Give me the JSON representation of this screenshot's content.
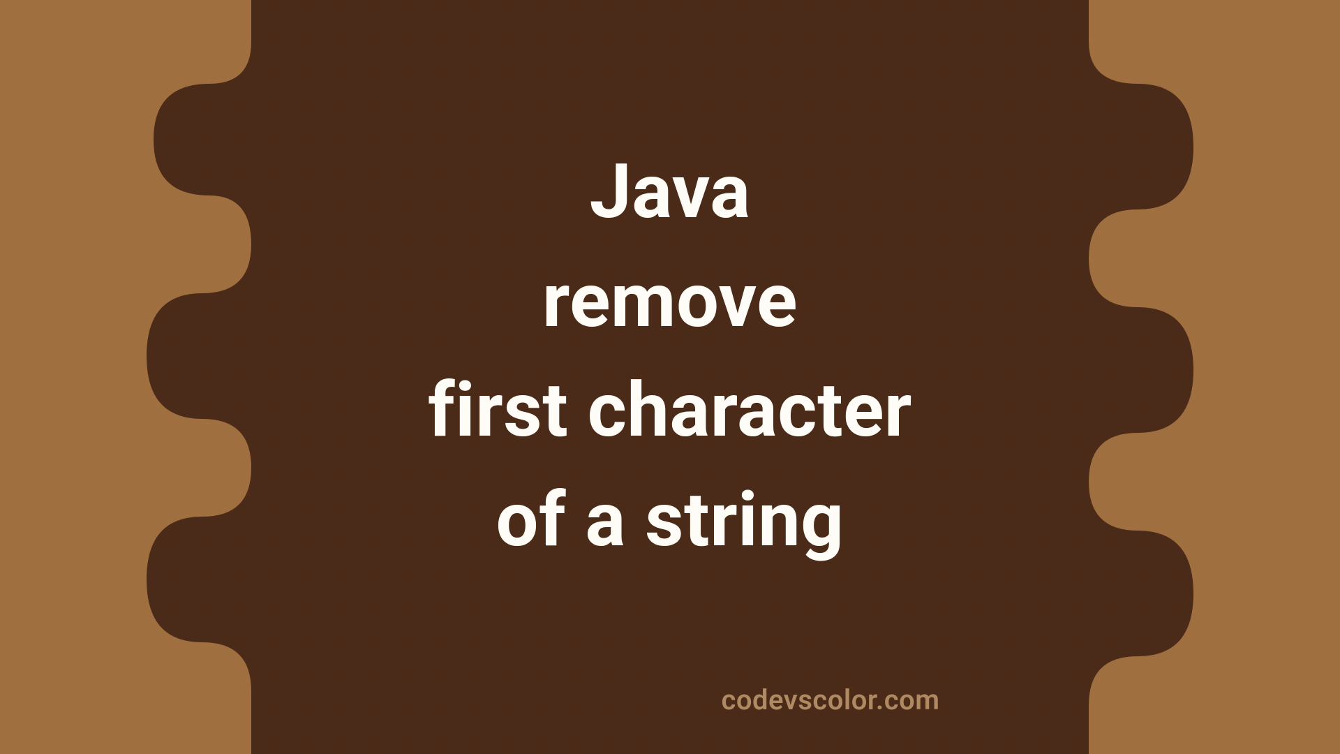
{
  "title_lines": "Java\nremove\nfirst character\nof a string",
  "watermark": "codevscolor.com",
  "colors": {
    "bg_outer": "#a07040",
    "bg_inner": "#4b2b18",
    "text": "#fffdf8",
    "watermark": "#b08a62"
  }
}
